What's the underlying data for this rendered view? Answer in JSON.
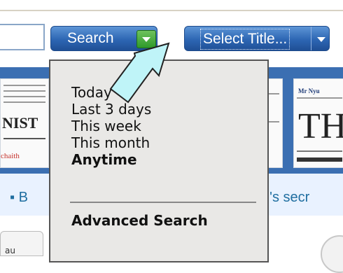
{
  "toolbar": {
    "search_label": "Search",
    "select_title_label": "Select Title..."
  },
  "background": {
    "thumb1_text": "NIST",
    "thumb1_red_text": "chaith",
    "thumb3_masthead": "Mr Nyu",
    "thumb3_text": "TH",
    "headline_left": "▪ B",
    "headline_right": "n's secr",
    "bottom_tab_text": "au"
  },
  "search_menu": {
    "items": [
      {
        "label": "Today",
        "selected": false
      },
      {
        "label": "Last 3 days",
        "selected": false
      },
      {
        "label": "This week",
        "selected": false
      },
      {
        "label": "This month",
        "selected": false
      },
      {
        "label": "Anytime",
        "selected": true
      }
    ],
    "advanced_label": "Advanced Search"
  },
  "colors": {
    "button_blue": "#2d66b3",
    "dropdown_arrow_green": "#2f9a2a",
    "menu_background": "#e9e8e6",
    "annotation_arrow": "#bff4f8"
  },
  "icons": {
    "search_dropdown": "chevron-down-icon",
    "title_dropdown": "chevron-down-icon",
    "annotation": "pointer-arrow-icon"
  }
}
